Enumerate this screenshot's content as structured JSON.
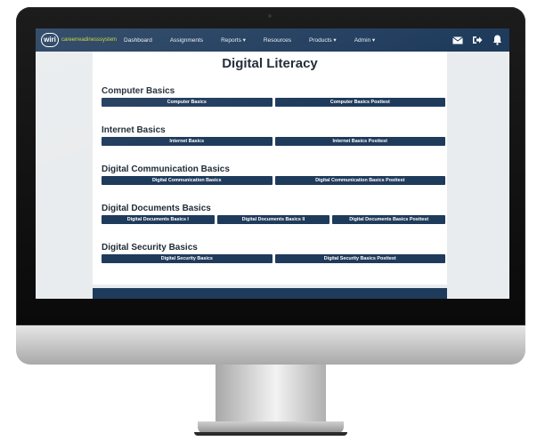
{
  "navbar": {
    "logo_mark": "wiri",
    "logo_text": "careerreadinesssystem",
    "links": [
      "Dashboard",
      "Assignments",
      "Reports ▾",
      "Resources",
      "Products ▾",
      "Admin ▾"
    ],
    "icons": [
      "mail-icon",
      "logout-icon",
      "bell-icon"
    ]
  },
  "page": {
    "title": "Digital Literacy"
  },
  "sections": [
    {
      "title": "Computer Basics",
      "buttons": [
        "Computer Basics",
        "Computer Basics Posttest"
      ]
    },
    {
      "title": "Internet Basics",
      "buttons": [
        "Internet Basics",
        "Internet Basics Posttest"
      ]
    },
    {
      "title": "Digital Communication Basics",
      "buttons": [
        "Digital Communication Basics",
        "Digital Communication Basics Posttest"
      ]
    },
    {
      "title": "Digital Documents Basics",
      "buttons": [
        "Digital Documents Basics I",
        "Digital Documents Basics II",
        "Digital Documents Basics Posttest"
      ]
    },
    {
      "title": "Digital Security Basics",
      "buttons": [
        "Digital Security Basics",
        "Digital Security Basics Posttest"
      ]
    }
  ],
  "colors": {
    "navbar": "#1f3b5c",
    "button": "#1f3b5c",
    "logo_accent": "#c7d62f",
    "screen_background": "#e9ecee"
  }
}
